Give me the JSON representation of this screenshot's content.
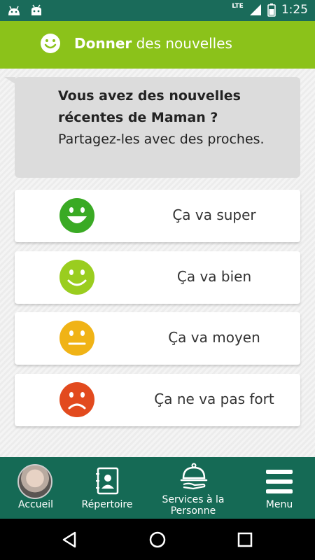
{
  "status_bar": {
    "network": "LTE",
    "time": "1:25",
    "icons": [
      "android-icon",
      "android-icon",
      "signal-icon",
      "battery-icon"
    ]
  },
  "header": {
    "title_bold": "Donner",
    "title_rest": " des nouvelles",
    "icon": "smiley-icon",
    "bg_color": "#8bc21a"
  },
  "prompt": {
    "question": "Vous avez des nouvelles récentes de Maman ?",
    "sub": "Partagez-les avec des proches."
  },
  "options": [
    {
      "label": "Ça va super",
      "icon": "big-smile-icon",
      "color": "#3aaa24"
    },
    {
      "label": "Ça va bien",
      "icon": "smile-icon",
      "color": "#9acd1f"
    },
    {
      "label": "Ça va moyen",
      "icon": "neutral-face-icon",
      "color": "#f0b316"
    },
    {
      "label": "Ça ne va pas fort",
      "icon": "sad-face-icon",
      "color": "#e24a1e"
    }
  ],
  "bottom_nav": {
    "accueil": "Accueil",
    "repertoire": "Répertoire",
    "services": "Services à la Personne",
    "menu": "Menu",
    "bg_color": "#156a55"
  }
}
